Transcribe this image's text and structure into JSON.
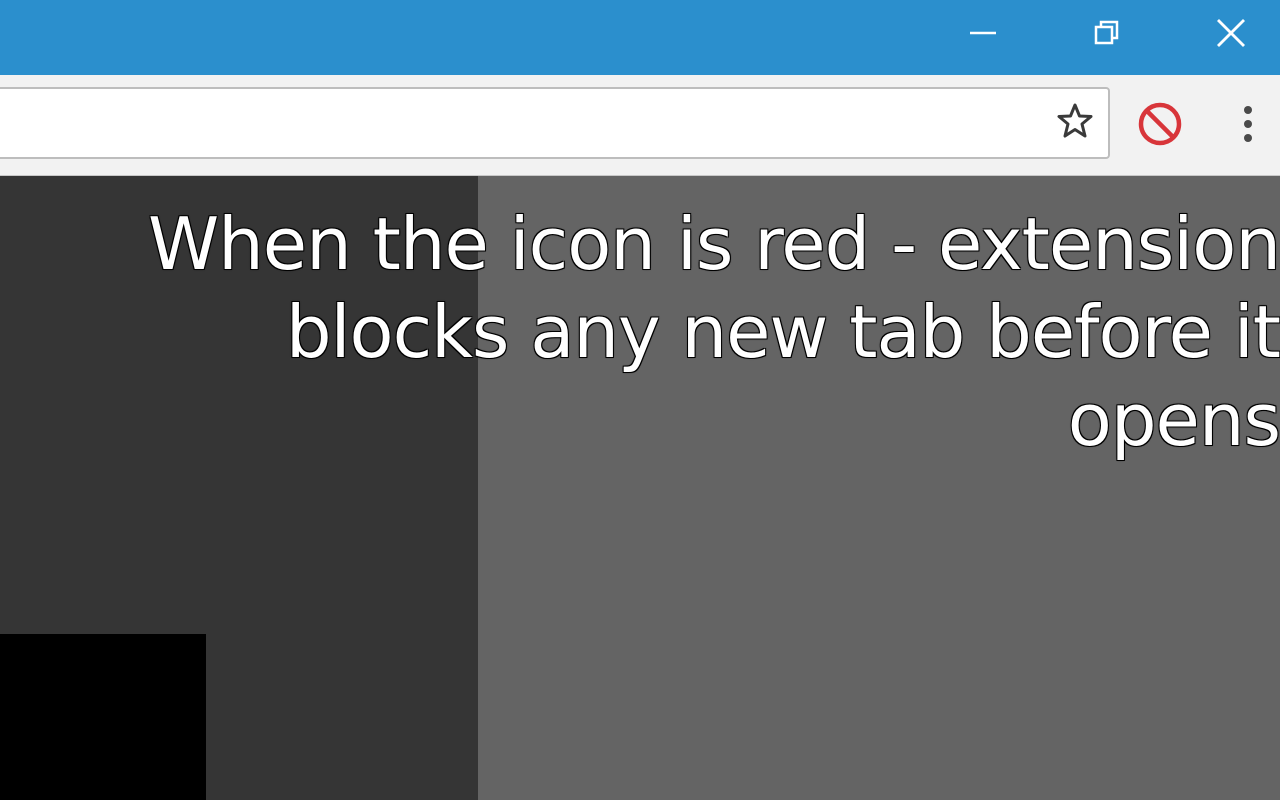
{
  "window": {
    "titlebar_color": "#2b8fcd",
    "controls": {
      "minimize_icon": "minimize-icon",
      "restore_icon": "restore-icon",
      "close_icon": "close-icon"
    }
  },
  "toolbar": {
    "address": {
      "value": "",
      "placeholder": ""
    },
    "bookmark_icon": "star-icon",
    "extension_icon": "block-icon",
    "extension_icon_color": "#d8353a",
    "menu_icon": "kebab-menu-icon"
  },
  "content": {
    "caption_lines": [
      "When the icon is red - extension",
      "blocks any new tab before it",
      "opens"
    ]
  }
}
